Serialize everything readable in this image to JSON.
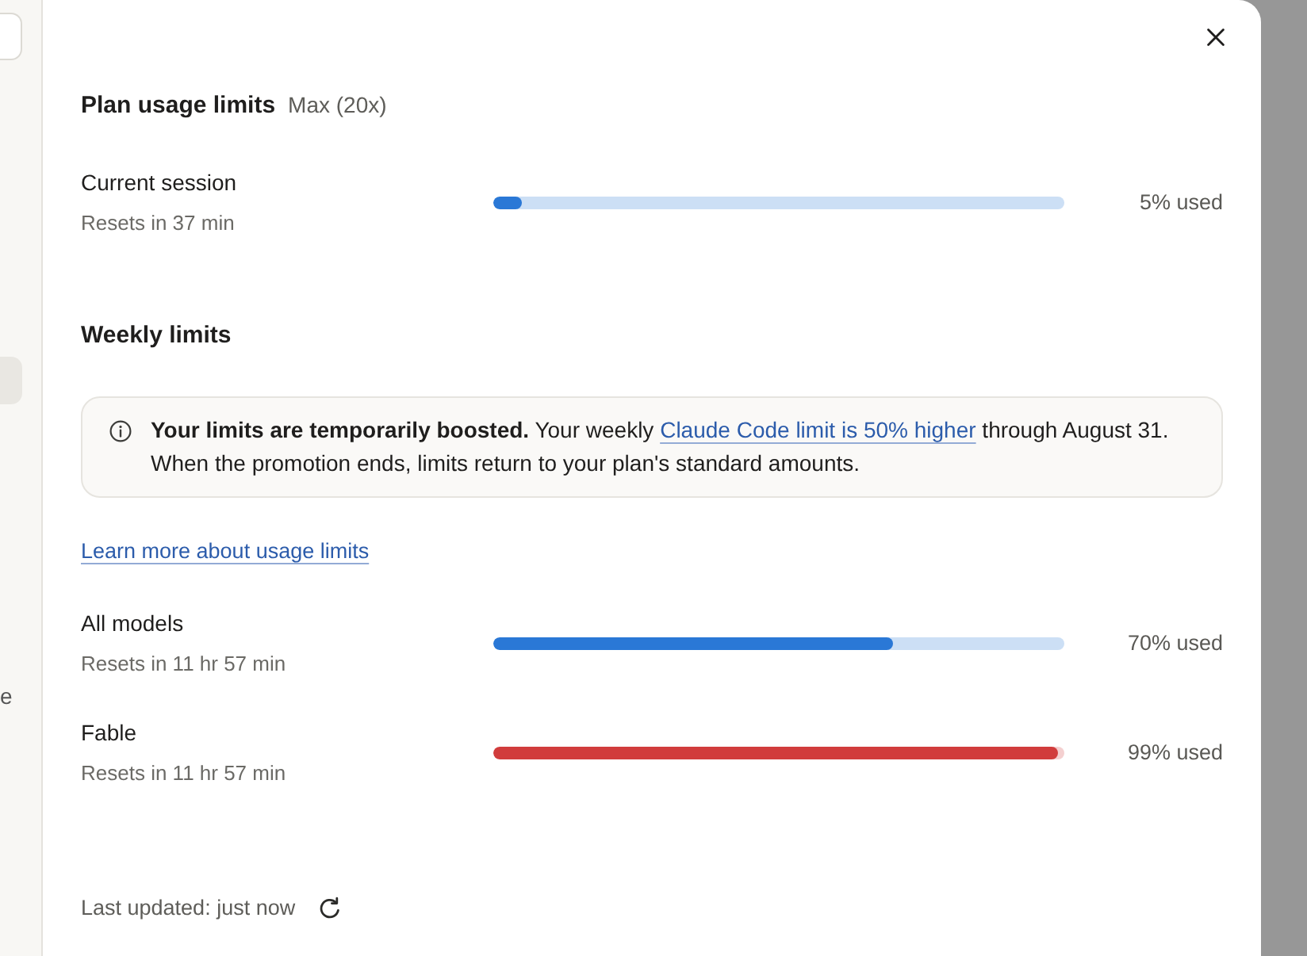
{
  "sidebar": {
    "items": [
      {
        "selected": true
      },
      {
        "label": "e",
        "selected": false
      }
    ]
  },
  "dialog": {
    "title": "Plan usage limits",
    "plan": "Max (20x)"
  },
  "session": {
    "name": "Current session",
    "resets": "Resets in 37 min",
    "level": 0.05,
    "reading": "5% used",
    "color": "#2a78d6"
  },
  "weekly": {
    "title": "Weekly limits",
    "notice": {
      "text_before": "**Your limits are temporarily boosted.** Your weekly ",
      "link": "Claude Code limit is 50% higher",
      "text_after": " through August 31. When the promotion ends, limits return to your plan's standard amounts."
    },
    "learn_more": "Learn more about usage limits",
    "meters": [
      {
        "name": "All models",
        "resets": "Resets in 11 hr 57 min",
        "level": 0.7,
        "reading": "70% used",
        "color": "#2a78d6"
      },
      {
        "name": "Fable",
        "resets": "Resets in 11 hr 57 min",
        "level": 0.99,
        "reading": "99% used",
        "color": "#d13c3c"
      }
    ]
  },
  "footer": {
    "text": "Last updated: just now"
  }
}
